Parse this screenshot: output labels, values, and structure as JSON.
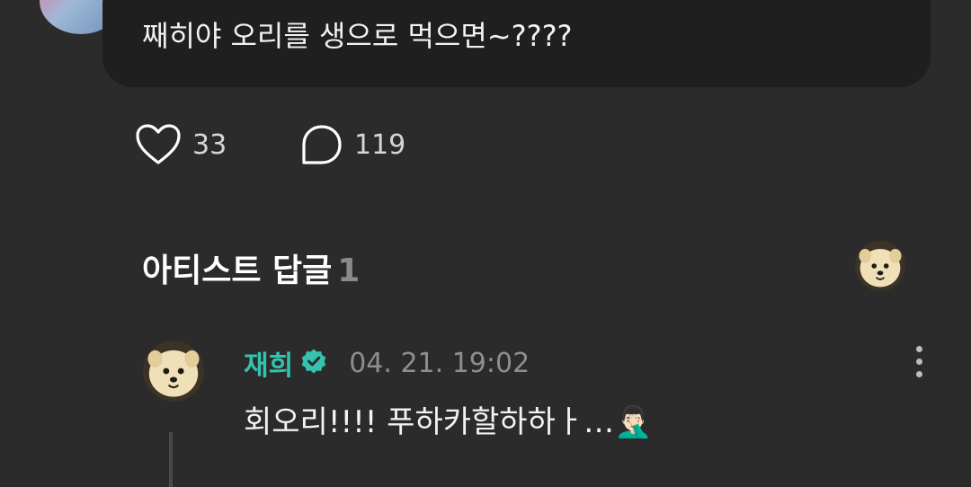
{
  "post": {
    "text": "째히야 오리를 생으로 먹으면~????",
    "likes": "33",
    "comments": "119"
  },
  "artist_replies": {
    "title": "아티스트 답글",
    "count": "1"
  },
  "reply": {
    "name": "재희",
    "date": "04. 21. 19:02",
    "text": "회오리!!!! 푸하카할하하ㅏ…🤦🏻‍♂️"
  },
  "colors": {
    "background": "#2b2b2b",
    "bubble": "#1f1f1f",
    "accent": "#35c3b0",
    "muted": "#8e8e8e"
  },
  "icons": [
    "heart-icon",
    "comment-icon",
    "verified-badge-icon",
    "more-vertical-icon"
  ]
}
